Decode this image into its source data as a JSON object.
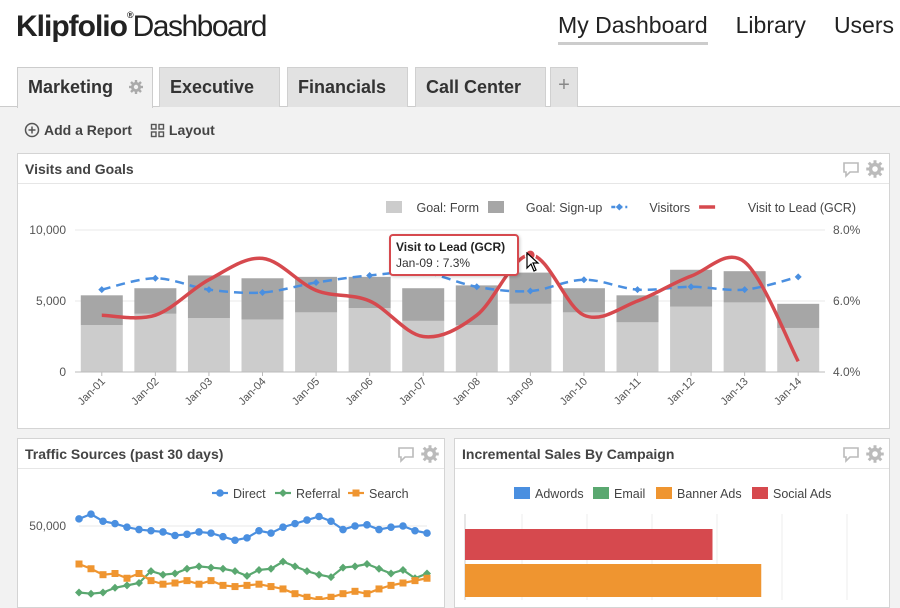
{
  "header": {
    "logo_brand": "Klipfolio",
    "logo_tm": "®",
    "logo_product": "Dashboard",
    "nav": [
      "My Dashboard",
      "Library",
      "Users"
    ]
  },
  "tabs": [
    {
      "label": "Marketing",
      "active": true
    },
    {
      "label": "Executive",
      "active": false
    },
    {
      "label": "Financials",
      "active": false
    },
    {
      "label": "Call Center",
      "active": false
    }
  ],
  "toolbar": {
    "add_report": "Add a Report",
    "layout": "Layout"
  },
  "colors": {
    "goal_form": "#cccccc",
    "goal_signup": "#a6a6a6",
    "visitors": "#4a8fe0",
    "gcr": "#d6494e",
    "direct": "#4a8fe0",
    "referral": "#5aa870",
    "search": "#ef9530",
    "adwords": "#4a8fe0",
    "email": "#5aa870",
    "banner_ads": "#ef9530",
    "social_ads": "#d6494e"
  },
  "visits_panel": {
    "title": "Visits and Goals",
    "tooltip": {
      "title": "Visit to Lead (GCR)",
      "value": "Jan-09 : 7.3%"
    }
  },
  "traffic_panel": {
    "title": "Traffic Sources (past 30 days)"
  },
  "sales_panel": {
    "title": "Incremental Sales By Campaign"
  },
  "chart_data": [
    {
      "type": "bar",
      "categories": [
        "Jan-01",
        "Jan-02",
        "Jan-03",
        "Jan-04",
        "Jan-05",
        "Jan-06",
        "Jan-07",
        "Jan-08",
        "Jan-09",
        "Jan-10",
        "Jan-11",
        "Jan-12",
        "Jan-13",
        "Jan-14"
      ],
      "series": [
        {
          "name": "Goal: Form",
          "kind": "bar",
          "values": [
            3300,
            4100,
            3800,
            3700,
            4200,
            4500,
            3600,
            3300,
            4800,
            4200,
            3500,
            4600,
            4900,
            3100
          ]
        },
        {
          "name": "Goal: Sign-up",
          "kind": "bar-stacked",
          "values": [
            2100,
            1800,
            3000,
            2900,
            2500,
            2200,
            2300,
            2800,
            2200,
            1700,
            1900,
            2600,
            2200,
            1700
          ]
        },
        {
          "name": "Visitors",
          "kind": "dashed-line",
          "axis": "left",
          "values": [
            5800,
            6600,
            5800,
            5600,
            6300,
            6800,
            7000,
            6000,
            5700,
            6500,
            5800,
            6000,
            5800,
            6700
          ]
        },
        {
          "name": "Visit to Lead (GCR)",
          "kind": "line",
          "axis": "right",
          "values": [
            5.6,
            5.6,
            6.6,
            7.2,
            6.3,
            6.0,
            5.0,
            5.6,
            7.3,
            5.6,
            6.0,
            6.7,
            7.1,
            4.3
          ]
        }
      ],
      "yticks_left": [
        "0",
        "5,000",
        "10,000"
      ],
      "yticks_right": [
        "4.0%",
        "6.0%",
        "8.0%"
      ],
      "ylim_left": [
        0,
        10000
      ],
      "ylim_right": [
        4.0,
        8.0
      ],
      "legend_position": "top-right"
    },
    {
      "type": "line",
      "title": "Traffic Sources (past 30 days)",
      "yticks": [
        "50,000"
      ],
      "series": [
        {
          "name": "Direct",
          "values": [
            53000,
            55000,
            52000,
            51000,
            49500,
            48500,
            48000,
            47500,
            46000,
            46500,
            47500,
            47000,
            45500,
            44000,
            45000,
            48000,
            47000,
            49500,
            51000,
            52500,
            54000,
            52000,
            48500,
            50000,
            50500,
            48500,
            49500,
            50000,
            48000,
            47000
          ]
        },
        {
          "name": "Referral",
          "values": [
            22000,
            21500,
            22000,
            24000,
            25000,
            26000,
            31000,
            29500,
            30000,
            32000,
            33000,
            32500,
            32000,
            31000,
            29000,
            31500,
            32000,
            35000,
            33000,
            31000,
            29500,
            28500,
            32500,
            33000,
            34000,
            32000,
            30000,
            31500,
            28000,
            30000
          ]
        },
        {
          "name": "Search",
          "values": [
            34000,
            32000,
            29500,
            30000,
            28000,
            30000,
            27000,
            25500,
            26000,
            27000,
            25500,
            27000,
            25000,
            24500,
            25000,
            25500,
            24500,
            23500,
            21500,
            20000,
            19000,
            20000,
            21500,
            22500,
            21500,
            23500,
            25000,
            26000,
            27000,
            28000
          ]
        }
      ],
      "legend_position": "top-right"
    },
    {
      "type": "bar",
      "title": "Incremental Sales By Campaign",
      "orientation": "horizontal",
      "series": [
        {
          "name": "Adwords"
        },
        {
          "name": "Email"
        },
        {
          "name": "Banner Ads",
          "values": [
            0.79
          ]
        },
        {
          "name": "Social Ads",
          "values": [
            0.66
          ]
        }
      ],
      "legend_position": "top"
    }
  ]
}
